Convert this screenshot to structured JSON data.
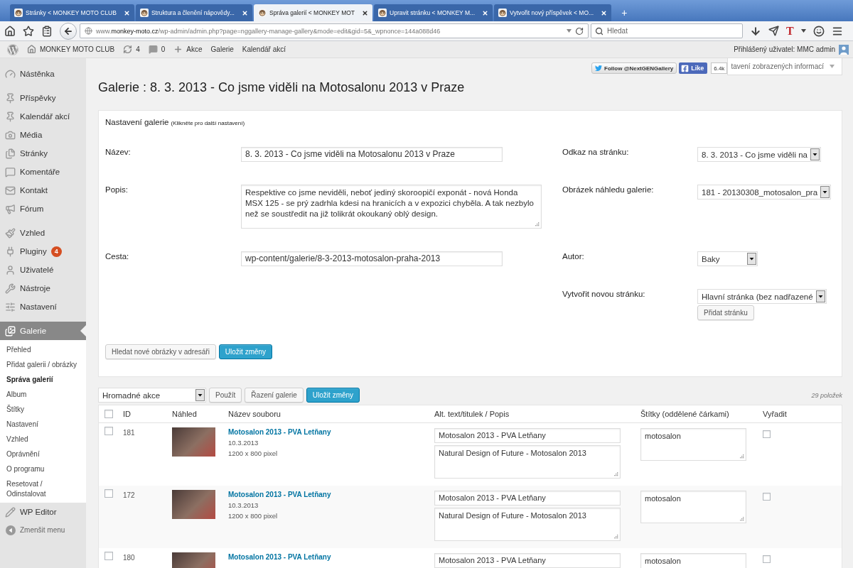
{
  "browser": {
    "tabs": [
      {
        "title": "Stránky < MONKEY MOTO CLUB",
        "selected": false
      },
      {
        "title": "Struktura a členění nápovědy...",
        "selected": false
      },
      {
        "title": "Správa galerií < MONKEY MOT",
        "selected": true
      },
      {
        "title": "Upravit stránku < MONKEY M...",
        "selected": false
      },
      {
        "title": "Vytvořit nový příspěvek < MO...",
        "selected": false
      }
    ],
    "new_tab": "+",
    "url": "www.**monkey-moto.cz**/wp-admin/admin.php?page=nggallery-manage-gallery&mode=edit&gid=5&_wpnonce=144a088d46",
    "search": {
      "placeholder": "Hledat"
    },
    "extension": "T"
  },
  "admin_bar": {
    "site": "MONKEY MOTO CLUB",
    "updates": "4",
    "comments": "0",
    "new": "Akce",
    "links": [
      "Galerie",
      "Kalendář akcí"
    ],
    "account": "Přihlášený uživatel: MMC admin"
  },
  "sidebar": {
    "sections": [
      {
        "items": [
          {
            "label": "Nástěnka",
            "selected": false
          }
        ]
      },
      {
        "items": [
          {
            "label": "Příspěvky",
            "selected": false
          },
          {
            "label": "Kalendář akcí",
            "selected": false
          },
          {
            "label": "Média",
            "selected": false
          },
          {
            "label": "Stránky",
            "selected": false
          },
          {
            "label": "Komentáře",
            "selected": false
          },
          {
            "label": "Kontakt",
            "selected": false
          },
          {
            "label": "Fórum",
            "selected": false
          }
        ]
      },
      {
        "items": [
          {
            "label": "Vzhled",
            "selected": false
          },
          {
            "label": "Pluginy",
            "selected": false,
            "badge": "4"
          },
          {
            "label": "Uživatelé",
            "selected": false
          },
          {
            "label": "Nástroje",
            "selected": false
          },
          {
            "label": "Nastavení",
            "selected": false
          }
        ]
      },
      {
        "items": [
          {
            "label": "Galerie",
            "selected": true,
            "submenu": [
              {
                "label": "Přehled",
                "selected": false
              },
              {
                "label": "Přidat galerii / obrázky",
                "selected": false
              },
              {
                "label": "Správa galerií",
                "selected": true
              },
              {
                "label": "Album",
                "selected": false
              },
              {
                "label": "Štítky",
                "selected": false
              },
              {
                "label": "Nastavení",
                "selected": false
              },
              {
                "label": "Vzhled",
                "selected": false
              },
              {
                "label": "Oprávnění",
                "selected": false
              },
              {
                "label": "O programu",
                "selected": false
              },
              {
                "label": "Resetovat / Odinstalovat",
                "selected": false
              }
            ]
          },
          {
            "label": "WP Editor",
            "selected": false
          }
        ]
      }
    ],
    "collapse": "Zmenšit menu"
  },
  "social": {
    "follow": "Follow @NextGENGallery",
    "like": "Like",
    "like_count": "6.4k"
  },
  "screen_options": "tavení zobrazených informací",
  "page_title": "Galerie : 8. 3. 2013 - Co jsme viděli na Motosalonu 2013 v Praze",
  "settings": {
    "title": "Nastavení galerie",
    "hint": "(Klikněte pro další nastavení)",
    "rows": [
      {
        "left": {
          "label": "Název:",
          "kind": "input",
          "value": "8. 3. 2013 - Co jsme viděli na Motosalonu 2013 v Praze"
        },
        "right": {
          "label": "Odkaz na stránku:",
          "kind": "select",
          "value": "8. 3. 2013 - Co jsme viděli na"
        }
      },
      {
        "left": {
          "label": "Popis:",
          "kind": "textarea",
          "value": "Respektive co jsme neviděli, neboť jediný skoroopičí exponát - nová Honda MSX 125 - se prý zadrhla kdesi na hranicích a v expozici chyběla. A tak nezbylo než se soustředit na již tolikrát okoukaný oblý design."
        },
        "right": {
          "label": "Obrázek náhledu galerie:",
          "kind": "select",
          "value": "181 - 20130308_motosalon_pra"
        }
      },
      {
        "left": {
          "label": "Cesta:",
          "kind": "input",
          "value": "wp-content/galerie/8-3-2013-motosalon-praha-2013"
        },
        "right": {
          "label": "Autor:",
          "kind": "select",
          "value": "Baky"
        }
      },
      {
        "right": {
          "label": "Vytvořit novou stránku:",
          "kind": "select",
          "value": "Hlavní stránka (bez nadřazené",
          "button": "Přidat stránku"
        }
      }
    ],
    "buttons": [
      {
        "label": "Hledat nové obrázky v adresáři",
        "primary": false
      },
      {
        "label": "Uložit změny",
        "primary": true
      }
    ]
  },
  "bulk": {
    "select": "Hromadné akce",
    "buttons": [
      {
        "label": "Použít",
        "primary": false
      },
      {
        "label": "Řazení galerie",
        "primary": false
      },
      {
        "label": "Uložit změny",
        "primary": true
      }
    ],
    "count": "29 položek"
  },
  "table": {
    "select_all_checked": false,
    "columns": [
      "ID",
      "Náhled",
      "Název souboru",
      "Alt. text/titulek / Popis",
      "Štítky (oddělené čárkami)",
      "Vyřadit"
    ],
    "rows": [
      {
        "checked": false,
        "id": "181",
        "title": "Motosalon 2013 - PVA Letňany",
        "date": "10.3.2013",
        "size": "1200 x 800 pixel",
        "alt": "Motosalon 2013 - PVA Letňany",
        "description": "Natural Design of Future - Motosalon 2013",
        "tags": "motosalon",
        "excluded": false
      },
      {
        "checked": false,
        "id": "172",
        "title": "Motosalon 2013 - PVA Letňany",
        "date": "10.3.2013",
        "size": "1200 x 800 pixel",
        "alt": "Motosalon 2013 - PVA Letňany",
        "description": "Natural Design of Future - Motosalon 2013",
        "tags": "motosalon",
        "excluded": false
      },
      {
        "checked": false,
        "id": "180",
        "title": "Motosalon 2013 - PVA Letňany",
        "alt": "Motosalon 2013 - PVA Letňany",
        "tags": "motosalon",
        "excluded": false
      }
    ]
  }
}
